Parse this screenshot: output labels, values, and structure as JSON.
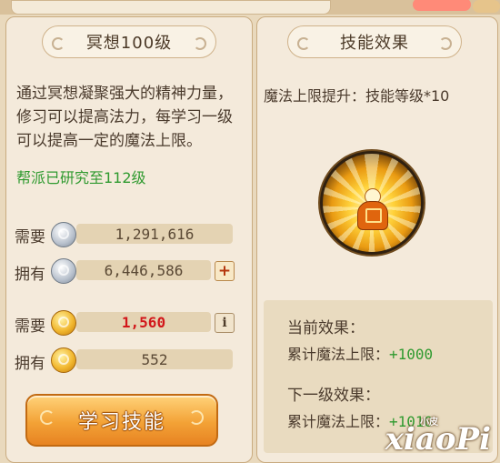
{
  "left_panel": {
    "title": "冥想100级",
    "description": "通过冥想凝聚强大的精神力量，修习可以提高法力，每学习一级可以提高一定的魔法上限。",
    "researched": "帮派已研究至112级",
    "costs": [
      {
        "label": "需要",
        "currency": "silver-coin-icon",
        "value": "1,291,616"
      },
      {
        "label": "拥有",
        "currency": "silver-coin-icon",
        "value": "6,446,586"
      },
      {
        "label": "需要",
        "currency": "gold-coin-icon",
        "value": "1,560"
      },
      {
        "label": "拥有",
        "currency": "gold-coin-icon",
        "value": "552"
      }
    ],
    "plus_label": "+",
    "info_label": "i",
    "learn_button": "学习技能"
  },
  "right_panel": {
    "title": "技能效果",
    "effect_line": "魔法上限提升：技能等级*10",
    "icon": "meditating-monk-skill-icon",
    "current_effect_title": "当前效果：",
    "current_effect_label": "累计魔法上限：",
    "current_effect_value": "+1000",
    "next_effect_title": "下一级效果：",
    "next_effect_label": "累计魔法上限：",
    "next_effect_value": "+1010"
  },
  "watermark": {
    "text": "xiaoPi",
    "small": "小皮"
  },
  "colors": {
    "panel": "#f4eadb",
    "accent_green": "#2f9a2f",
    "red_value": "#d2161a",
    "button_orange": "#f3a236"
  }
}
